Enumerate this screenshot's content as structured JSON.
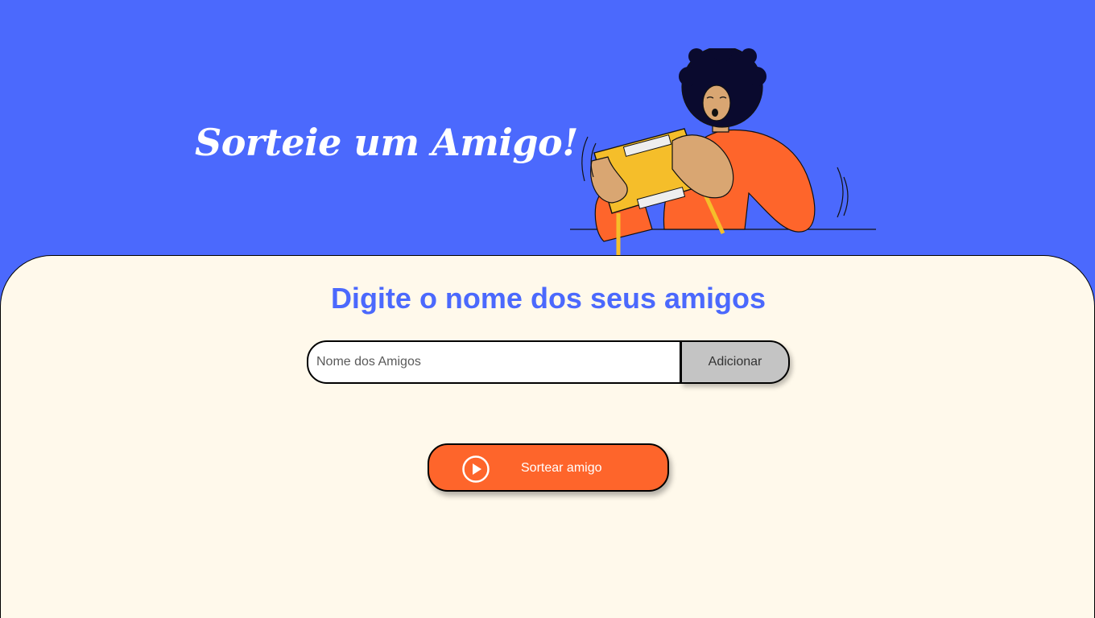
{
  "header": {
    "title": "Sorteie um Amigo!",
    "illustration_icon": "person-playing-handheld-console-illustration"
  },
  "main": {
    "heading": "Digite o nome dos seus amigos",
    "name_input": {
      "placeholder": "Nome dos Amigos",
      "value": ""
    },
    "add_button_label": "Adicionar",
    "draw_button": {
      "label": "Sortear amigo",
      "icon": "play-circle-icon"
    }
  },
  "colors": {
    "header_bg": "#4B69FD",
    "main_bg": "#FFF9EB",
    "accent_orange": "#FE652B",
    "heading_blue": "#4B69FD",
    "add_button_bg": "#C4C4C4"
  }
}
